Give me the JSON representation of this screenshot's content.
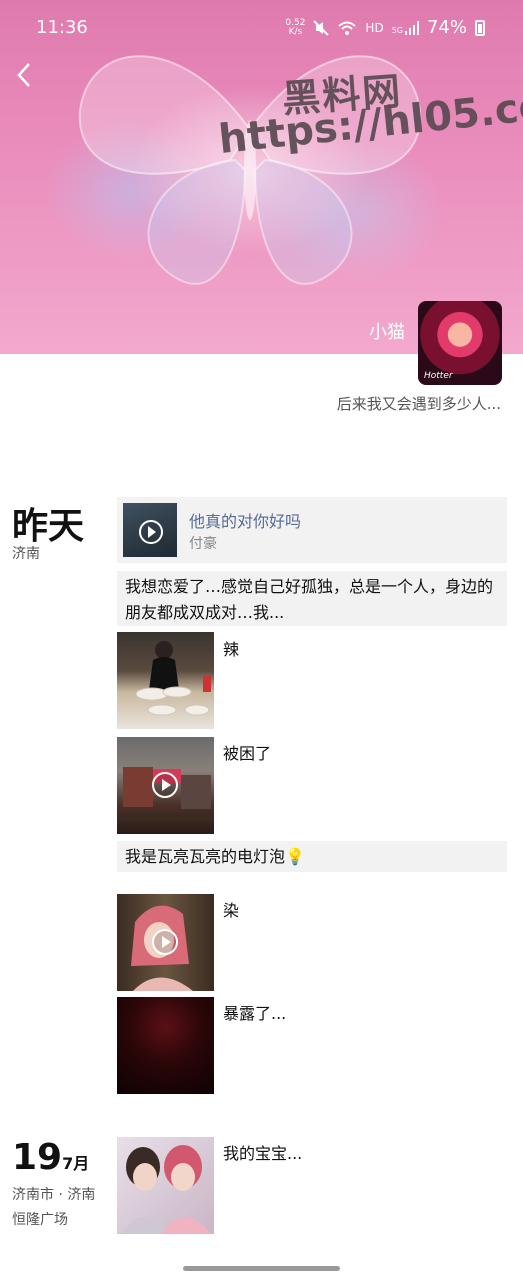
{
  "status_bar": {
    "time": "11:36",
    "net_speed_value": "0.52",
    "net_speed_unit": "K/s",
    "hd": "HD",
    "network": "5G",
    "battery": "74%"
  },
  "cover": {
    "watermark_line1": "黑料网",
    "watermark_line2": "https://hl05.co"
  },
  "profile": {
    "name": "小猫",
    "avatar_tag": "Hotter",
    "signature": "后来我又会遇到多少人..."
  },
  "groups": [
    {
      "date": "昨天",
      "location": "济南"
    },
    {
      "day": "19",
      "month": "7月",
      "location": "济南市 · 济南恒隆广场"
    }
  ],
  "posts": {
    "share_title": "他真的对你好吗",
    "share_author": "付豪",
    "text1": "我想恋爱了…感觉自己好孤独，总是一个人，身边的朋友都成双成对…我...",
    "caption_spicy": "辣",
    "caption_trapped": "被困了",
    "text2": "我是瓦亮瓦亮的电灯泡💡",
    "caption_ran": "染",
    "caption_exposed": "暴露了...",
    "caption_baby": "我的宝宝..."
  }
}
